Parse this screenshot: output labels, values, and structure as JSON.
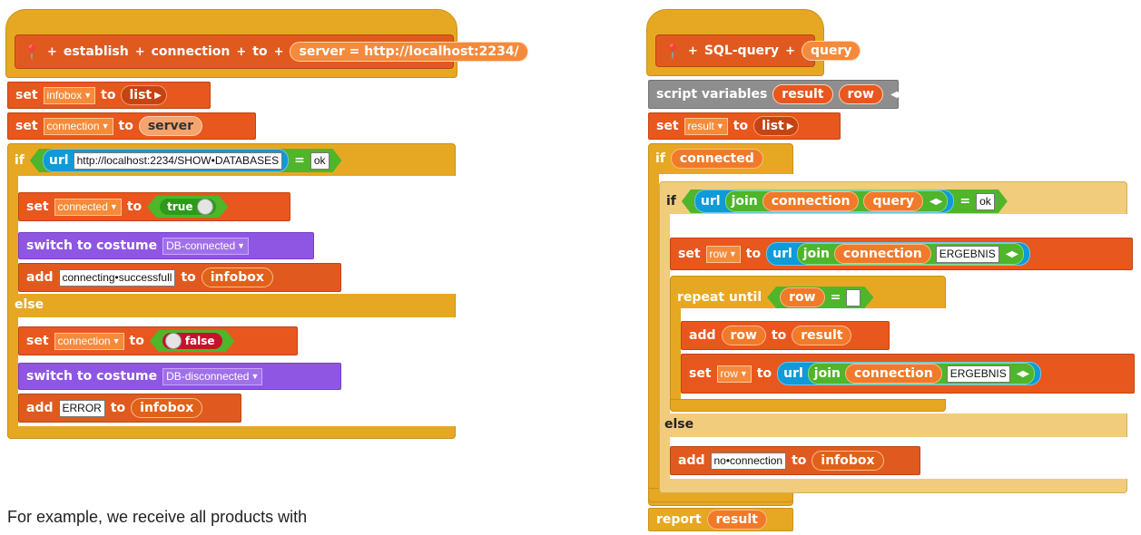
{
  "left_script": {
    "hat": {
      "words": [
        "establish",
        "connection",
        "to"
      ],
      "param_label": "server = http://localhost:2234/"
    },
    "set_infobox": {
      "set": "set",
      "var": "infobox",
      "to": "to",
      "value": "list"
    },
    "set_connection": {
      "set": "set",
      "var": "connection",
      "to": "to",
      "value": "server"
    },
    "if_block": {
      "if": "if",
      "url_label": "url",
      "url_value": "http://localhost:2234/SHOW•DATABASES",
      "eq": "=",
      "compare_value": "ok"
    },
    "then": {
      "set_connected": {
        "set": "set",
        "var": "connected",
        "to": "to",
        "value": "true"
      },
      "costume": {
        "label": "switch to costume",
        "value": "DB-connected"
      },
      "add": {
        "add": "add",
        "text": "connecting•successfull",
        "to": "to",
        "target": "infobox"
      }
    },
    "else_label": "else",
    "else": {
      "set_connection": {
        "set": "set",
        "var": "connection",
        "to": "to",
        "value": "false"
      },
      "costume": {
        "label": "switch to costume",
        "value": "DB-disconnected"
      },
      "add": {
        "add": "add",
        "text": "ERROR",
        "to": "to",
        "target": "infobox"
      }
    }
  },
  "right_script": {
    "hat": {
      "name": "SQL-query",
      "param": "query"
    },
    "script_vars": {
      "label": "script variables",
      "vars": [
        "result",
        "row"
      ]
    },
    "set_result": {
      "set": "set",
      "var": "result",
      "to": "to",
      "value": "list"
    },
    "outer_if": {
      "if": "if",
      "condition": "connected"
    },
    "inner_if": {
      "if": "if",
      "url_label": "url",
      "join_label": "join",
      "join_a": "connection",
      "join_b": "query",
      "eq": "=",
      "compare_value": "ok"
    },
    "set_row": {
      "set": "set",
      "var": "row",
      "to": "to",
      "url_label": "url",
      "join_label": "join",
      "join_a": "connection",
      "join_b": "ERGEBNIS"
    },
    "repeat": {
      "label": "repeat until",
      "var": "row",
      "eq": "="
    },
    "add_row": {
      "add": "add",
      "var": "row",
      "to": "to",
      "target": "result"
    },
    "set_row2": {
      "set": "set",
      "var": "row",
      "to": "to",
      "url_label": "url",
      "join_label": "join",
      "join_a": "connection",
      "join_b": "ERGEBNIS"
    },
    "else_label": "else",
    "add_noconn": {
      "add": "add",
      "text": "no•connection",
      "to": "to",
      "target": "infobox"
    },
    "report": {
      "label": "report",
      "value": "result"
    }
  },
  "caption": "For example, we receive all products with",
  "colors": {
    "control": "#e6a822",
    "variables": "#e8571e",
    "looks": "#8f56e3",
    "operators": "#4fb52a",
    "sensing": "#0f9ad8"
  }
}
